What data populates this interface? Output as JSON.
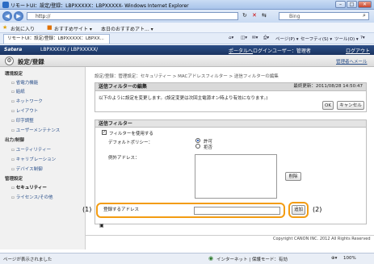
{
  "window": {
    "title": "リモートUI：設定/登録：LBPXXXXX：LBPXXXXX- Windows Internet Explorer",
    "url": "http://",
    "search_placeholder": "Bing"
  },
  "favorites": {
    "label": "お気に入り",
    "suggested": "おすすめサイト ▾",
    "today": "本日のおすすめアト... ▾"
  },
  "tab": {
    "label": "リモートUI：設定/登録：LBPXXXXX：LBPXX..."
  },
  "commands": {
    "page": "ページ(P) ▾",
    "safety": "セーフティ(S) ▾",
    "tools": "ツール(O) ▾"
  },
  "app": {
    "brand": "Satera",
    "device": "LBPXXXXX / LBPXXXXX/",
    "portal": "ポータルへ",
    "login_user": "ログインユーザー：管理者",
    "logout": "ログアウト",
    "section_title": "設定/登録",
    "admin_mail": "管理者へメール"
  },
  "sidebar": {
    "groups": [
      {
        "title": "環境設定",
        "items": [
          "省電力機能",
          "給紙",
          "ネットワーク",
          "レイアウト",
          "印字調整",
          "ユーザーメンテナンス"
        ]
      },
      {
        "title": "出力/制御",
        "items": [
          "ユーティリティー",
          "キャリブレーション",
          "デバイス制御"
        ]
      },
      {
        "title": "管理設定",
        "items": [
          "セキュリティー",
          "ライセンス/その他"
        ]
      }
    ]
  },
  "main": {
    "breadcrumb": "設定/登録：管理設定：セキュリティー > MACアドレスフィルター > 送信フィルターの編集",
    "panel_title": "送信フィルターの編集",
    "last_updated": "最終更新：2011/08/28 14:50:47",
    "message": "以下のように設定を変更します。(設定変更は次回主電源オン時より有効になります。)",
    "ok_button": "OK",
    "cancel_button": "キャンセル",
    "filter_section": "送信フィルター",
    "use_filter_label": "フィルターを使用する",
    "default_policy_label": "デフォルトポリシー：",
    "policy_allow": "許可",
    "policy_deny": "拒否",
    "exception_label": "例外アドレス：",
    "delete_button": "削除",
    "register_label": "登録するアドレス",
    "add_button": "追加",
    "callout_1": "(1)",
    "callout_2": "(2)",
    "footer_icon_label": "▣",
    "copyright": "Copyright CANON INC. 2012 All Rights Reserved"
  },
  "statusbar": {
    "left": "ページが表示されました",
    "zone": "インターネット | 保護モード：有効",
    "zoom": "100%"
  }
}
